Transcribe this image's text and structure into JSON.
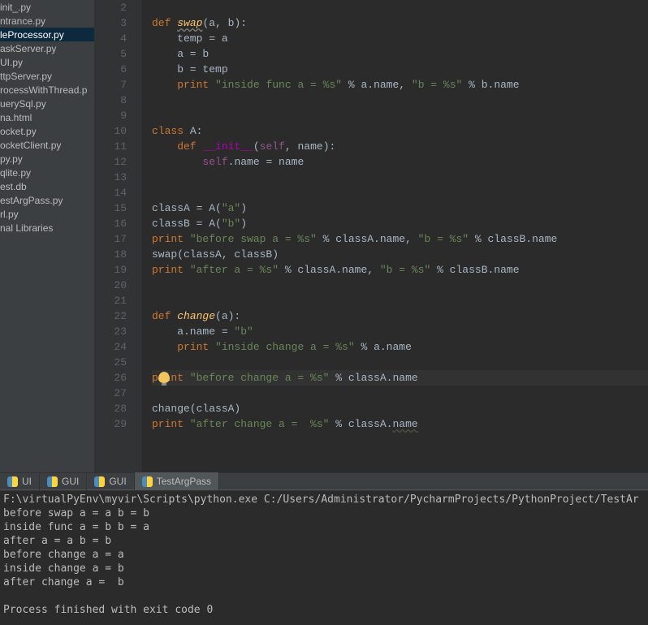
{
  "sidebar": {
    "items": [
      "init_.py",
      "ntrance.py",
      "leProcessor.py",
      "askServer.py",
      "UI.py",
      "ttpServer.py",
      "rocessWithThread.p",
      "uerySql.py",
      "na.html",
      "ocket.py",
      "ocketClient.py",
      "py.py",
      "qlite.py",
      "est.db",
      "estArgPass.py",
      "rl.py",
      "nal Libraries"
    ],
    "selected_index": 2
  },
  "gutter": {
    "start": 2,
    "end": 29
  },
  "code": {
    "lines": [
      {
        "n": 2,
        "segs": [
          {
            "t": "",
            "c": ""
          }
        ]
      },
      {
        "n": 3,
        "segs": [
          {
            "c": "kw",
            "t": "def "
          },
          {
            "c": "def-name warn",
            "t": "swap"
          },
          {
            "t": "(a, b):"
          }
        ]
      },
      {
        "n": 4,
        "segs": [
          {
            "t": "    temp = a"
          }
        ]
      },
      {
        "n": 5,
        "segs": [
          {
            "t": "    a = b"
          }
        ]
      },
      {
        "n": 6,
        "segs": [
          {
            "t": "    b = temp"
          }
        ]
      },
      {
        "n": 7,
        "segs": [
          {
            "t": "    "
          },
          {
            "c": "kw",
            "t": "print "
          },
          {
            "c": "str",
            "t": "\"inside func a = %s\""
          },
          {
            "t": " % a.name, "
          },
          {
            "c": "str",
            "t": "\"b = %s\""
          },
          {
            "t": " % b.name"
          }
        ]
      },
      {
        "n": 8,
        "segs": [
          {
            "t": ""
          }
        ]
      },
      {
        "n": 9,
        "segs": [
          {
            "t": ""
          }
        ]
      },
      {
        "n": 10,
        "segs": [
          {
            "c": "kw",
            "t": "class "
          },
          {
            "t": "A:"
          }
        ]
      },
      {
        "n": 11,
        "segs": [
          {
            "t": "    "
          },
          {
            "c": "kw",
            "t": "def "
          },
          {
            "c": "magic",
            "t": "__init__"
          },
          {
            "t": "("
          },
          {
            "c": "self",
            "t": "self"
          },
          {
            "t": ", name):"
          }
        ]
      },
      {
        "n": 12,
        "segs": [
          {
            "t": "        "
          },
          {
            "c": "self",
            "t": "self"
          },
          {
            "t": ".name = name"
          }
        ]
      },
      {
        "n": 13,
        "segs": [
          {
            "t": ""
          }
        ]
      },
      {
        "n": 14,
        "segs": [
          {
            "t": ""
          }
        ]
      },
      {
        "n": 15,
        "segs": [
          {
            "t": "classA = A("
          },
          {
            "c": "str",
            "t": "\"a\""
          },
          {
            "t": ")"
          }
        ]
      },
      {
        "n": 16,
        "segs": [
          {
            "t": "classB = A("
          },
          {
            "c": "str",
            "t": "\"b\""
          },
          {
            "t": ")"
          }
        ]
      },
      {
        "n": 17,
        "segs": [
          {
            "c": "kw",
            "t": "print "
          },
          {
            "c": "str",
            "t": "\"before swap a = %s\""
          },
          {
            "t": " % classA.name, "
          },
          {
            "c": "str",
            "t": "\"b = %s\""
          },
          {
            "t": " % classB.name"
          }
        ]
      },
      {
        "n": 18,
        "segs": [
          {
            "t": "swap(classA, classB)"
          }
        ]
      },
      {
        "n": 19,
        "segs": [
          {
            "c": "kw",
            "t": "print "
          },
          {
            "c": "str",
            "t": "\"after a = %s\""
          },
          {
            "t": " % classA.name, "
          },
          {
            "c": "str",
            "t": "\"b = %s\""
          },
          {
            "t": " % classB.name"
          }
        ]
      },
      {
        "n": 20,
        "segs": [
          {
            "t": ""
          }
        ]
      },
      {
        "n": 21,
        "segs": [
          {
            "t": ""
          }
        ]
      },
      {
        "n": 22,
        "segs": [
          {
            "c": "kw",
            "t": "def "
          },
          {
            "c": "def-name",
            "t": "change"
          },
          {
            "t": "(a):"
          }
        ]
      },
      {
        "n": 23,
        "segs": [
          {
            "t": "    a.name = "
          },
          {
            "c": "str",
            "t": "\"b\""
          }
        ]
      },
      {
        "n": 24,
        "segs": [
          {
            "t": "    "
          },
          {
            "c": "kw",
            "t": "print "
          },
          {
            "c": "str",
            "t": "\"inside change a = %s\""
          },
          {
            "t": " % a.name"
          }
        ]
      },
      {
        "n": 25,
        "segs": [
          {
            "t": ""
          }
        ]
      },
      {
        "n": 26,
        "hl": true,
        "bulb": true,
        "segs": [
          {
            "c": "kw",
            "t": "print "
          },
          {
            "c": "str",
            "t": "\"before change a = %s\""
          },
          {
            "t": " % classA.name"
          }
        ]
      },
      {
        "n": 27,
        "segs": [
          {
            "t": ""
          }
        ]
      },
      {
        "n": 28,
        "segs": [
          {
            "t": "change(classA)"
          }
        ]
      },
      {
        "n": 29,
        "segs": [
          {
            "c": "kw",
            "t": "print "
          },
          {
            "c": "str",
            "t": "\"after change a =  %s\""
          },
          {
            "t": " % classA."
          },
          {
            "c": "warn2",
            "t": "name"
          }
        ]
      }
    ]
  },
  "run_tabs": [
    {
      "label": "UI",
      "active": false
    },
    {
      "label": "GUI",
      "active": false
    },
    {
      "label": "GUI",
      "active": false
    },
    {
      "label": "TestArgPass",
      "active": true
    }
  ],
  "console": {
    "lines": [
      "F:\\virtualPyEnv\\myvir\\Scripts\\python.exe C:/Users/Administrator/PycharmProjects/PythonProject/TestAr",
      "before swap a = a b = b",
      "inside func a = b b = a",
      "after a = a b = b",
      "before change a = a",
      "inside change a = b",
      "after change a =  b",
      "",
      "Process finished with exit code 0",
      ""
    ]
  }
}
